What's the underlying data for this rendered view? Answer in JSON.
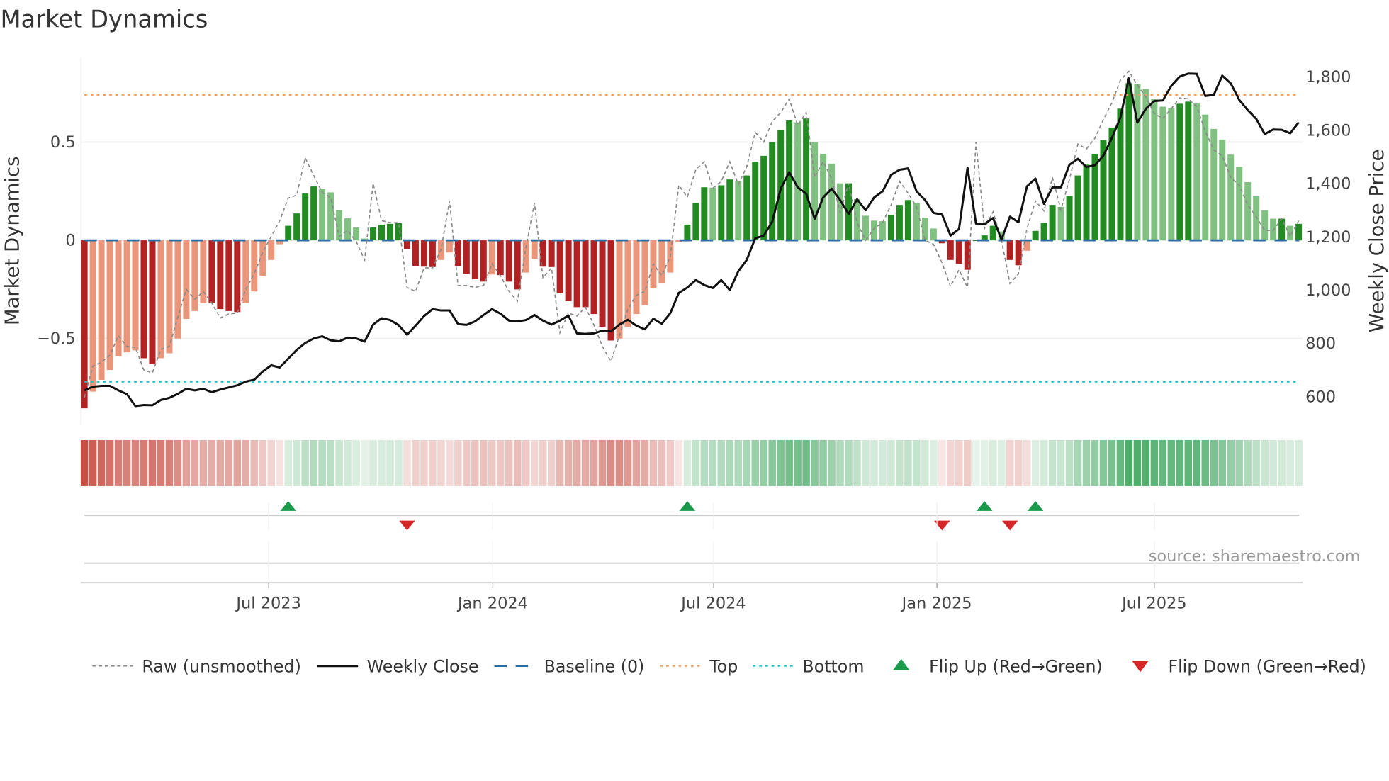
{
  "title": "Market Dynamics",
  "source": "source: sharemaestro.com",
  "colors": {
    "bar_up_strong": "#228b22",
    "bar_up_weak": "#80c080",
    "bar_down_strong": "#b22222",
    "bar_down_weak": "#e9967a",
    "raw": "#888888",
    "close": "#111111",
    "baseline": "#2b6ea6",
    "top": "#f0a060",
    "bottom": "#20c0d0",
    "flip_up": "#1a9a4a",
    "flip_down": "#d62728",
    "heat_red": "#c0392b",
    "heat_green": "#2e9e4f"
  },
  "chart_data": {
    "type": "bar+line",
    "title": "Market Dynamics",
    "ylabel": "Market Dynamics",
    "y2label": "Weekly Close Price",
    "ylim": [
      -0.94,
      0.93
    ],
    "y2lim": [
      494,
      1873
    ],
    "yticks": [
      {
        "value": -0.5,
        "label": "−0.5"
      },
      {
        "value": 0,
        "label": "0"
      },
      {
        "value": 0.5,
        "label": "0.5"
      }
    ],
    "y2ticks": [
      {
        "value": 600,
        "label": "600"
      },
      {
        "value": 800,
        "label": "800"
      },
      {
        "value": 1000,
        "label": "1,000"
      },
      {
        "value": 1200,
        "label": "1,200"
      },
      {
        "value": 1400,
        "label": "1,400"
      },
      {
        "value": 1600,
        "label": "1,600"
      },
      {
        "value": 1800,
        "label": "1,800"
      }
    ],
    "xticks": [
      {
        "label": "Jul 2023",
        "week_index": 21.7
      },
      {
        "label": "Jan 2024",
        "week_index": 48.1
      },
      {
        "label": "Jul 2024",
        "week_index": 74.1
      },
      {
        "label": "Jan 2025",
        "week_index": 100.4
      },
      {
        "label": "Jul 2025",
        "week_index": 126.0
      }
    ],
    "top_level": 0.74,
    "bottom_level": -0.72,
    "baseline": 0,
    "grid": true,
    "legend_position": "bottom",
    "smoothed": [
      -0.855,
      -0.77,
      -0.71,
      -0.66,
      -0.59,
      -0.57,
      -0.56,
      -0.6,
      -0.63,
      -0.6,
      -0.575,
      -0.5,
      -0.4,
      -0.36,
      -0.32,
      -0.32,
      -0.35,
      -0.36,
      -0.365,
      -0.32,
      -0.26,
      -0.18,
      -0.1,
      -0.02,
      0.074,
      0.137,
      0.238,
      0.274,
      0.262,
      0.244,
      0.154,
      0.112,
      0.065,
      0.009,
      0.065,
      0.08,
      0.084,
      0.087,
      -0.045,
      -0.13,
      -0.134,
      -0.136,
      -0.1,
      -0.062,
      -0.13,
      -0.17,
      -0.197,
      -0.21,
      -0.174,
      -0.177,
      -0.21,
      -0.25,
      -0.164,
      -0.094,
      -0.134,
      -0.136,
      -0.27,
      -0.31,
      -0.34,
      -0.34,
      -0.375,
      -0.44,
      -0.51,
      -0.5,
      -0.44,
      -0.375,
      -0.33,
      -0.245,
      -0.22,
      -0.164,
      -0.01,
      0.08,
      0.19,
      0.27,
      0.268,
      0.28,
      0.31,
      0.3,
      0.33,
      0.4,
      0.43,
      0.5,
      0.56,
      0.61,
      0.6,
      0.62,
      0.5,
      0.44,
      0.39,
      0.29,
      0.29,
      0.21,
      0.125,
      0.1,
      0.097,
      0.13,
      0.18,
      0.205,
      0.19,
      0.115,
      0.06,
      -0.015,
      -0.1,
      -0.12,
      -0.15,
      0.0,
      0.025,
      0.074,
      0.045,
      -0.1,
      -0.127,
      -0.053,
      0.048,
      0.089,
      0.18,
      0.17,
      0.226,
      0.33,
      0.385,
      0.44,
      0.51,
      0.574,
      0.67,
      0.8,
      0.795,
      0.77,
      0.72,
      0.68,
      0.675,
      0.695,
      0.706,
      0.696,
      0.64,
      0.567,
      0.513,
      0.436,
      0.375,
      0.296,
      0.224,
      0.153,
      0.11,
      0.11,
      0.074,
      0.084
    ],
    "raw": [
      -0.8,
      -0.64,
      -0.62,
      -0.585,
      -0.485,
      -0.54,
      -0.545,
      -0.66,
      -0.675,
      -0.555,
      -0.54,
      -0.39,
      -0.25,
      -0.3,
      -0.26,
      -0.32,
      -0.395,
      -0.375,
      -0.37,
      -0.25,
      -0.17,
      -0.06,
      0.02,
      0.1,
      0.215,
      0.23,
      0.42,
      0.33,
      0.244,
      0.217,
      0.02,
      0.05,
      -0.005,
      -0.1,
      0.29,
      0.1,
      0.09,
      0.09,
      -0.24,
      -0.26,
      -0.14,
      -0.14,
      -0.046,
      0.2,
      -0.23,
      -0.23,
      -0.24,
      -0.23,
      -0.12,
      -0.18,
      -0.26,
      -0.31,
      -0.035,
      0.19,
      -0.19,
      -0.14,
      -0.47,
      -0.37,
      -0.385,
      -0.34,
      -0.43,
      -0.54,
      -0.615,
      -0.485,
      -0.35,
      -0.28,
      -0.26,
      -0.12,
      -0.18,
      -0.08,
      0.28,
      0.22,
      0.36,
      0.4,
      0.265,
      0.3,
      0.4,
      0.285,
      0.375,
      0.55,
      0.5,
      0.605,
      0.65,
      0.72,
      0.585,
      0.65,
      0.32,
      0.4,
      0.315,
      0.14,
      0.29,
      0.09,
      0.0,
      0.06,
      0.09,
      0.18,
      0.3,
      0.24,
      0.17,
      0.0,
      -0.02,
      -0.115,
      -0.235,
      -0.15,
      -0.24,
      0.5,
      0.06,
      0.145,
      0.0,
      -0.22,
      -0.17,
      0.06,
      0.2,
      0.15,
      0.32,
      0.155,
      0.31,
      0.49,
      0.465,
      0.52,
      0.615,
      0.7,
      0.815,
      0.86,
      0.79,
      0.73,
      0.645,
      0.62,
      0.67,
      0.725,
      0.72,
      0.68,
      0.555,
      0.46,
      0.43,
      0.32,
      0.28,
      0.18,
      0.12,
      0.05,
      0.05,
      0.11,
      0.02,
      0.1
    ],
    "weekly_close": [
      624,
      638,
      641,
      641,
      624,
      610,
      565,
      569,
      568,
      588,
      596,
      611,
      630,
      624,
      630,
      617,
      627,
      635,
      643,
      657,
      664,
      695,
      718,
      710,
      743,
      776,
      802,
      819,
      827,
      812,
      808,
      822,
      819,
      807,
      871,
      895,
      888,
      869,
      833,
      867,
      903,
      929,
      924,
      924,
      873,
      870,
      883,
      907,
      929,
      912,
      886,
      883,
      888,
      907,
      886,
      871,
      886,
      905,
      838,
      836,
      838,
      848,
      845,
      871,
      889,
      867,
      853,
      893,
      874,
      914,
      990,
      1010,
      1038,
      1019,
      1008,
      1038,
      1000,
      1071,
      1114,
      1195,
      1205,
      1257,
      1381,
      1443,
      1386,
      1362,
      1267,
      1348,
      1381,
      1338,
      1286,
      1341,
      1300,
      1348,
      1371,
      1433,
      1452,
      1457,
      1371,
      1338,
      1290,
      1284,
      1205,
      1230,
      1460,
      1250,
      1248,
      1271,
      1190,
      1276,
      1255,
      1390,
      1419,
      1324,
      1386,
      1386,
      1471,
      1493,
      1462,
      1469,
      1505,
      1571,
      1648,
      1795,
      1629,
      1681,
      1710,
      1712,
      1767,
      1802,
      1813,
      1812,
      1729,
      1733,
      1805,
      1776,
      1714,
      1676,
      1643,
      1586,
      1603,
      1602,
      1589,
      1630
    ],
    "flip_up_weeks": [
      24,
      71,
      106,
      112
    ],
    "flip_down_weeks": [
      38,
      101,
      109
    ]
  },
  "legend": [
    {
      "label": "Raw (unsmoothed)",
      "icon": "dashed-line"
    },
    {
      "label": "Weekly Close",
      "icon": "solid-line"
    },
    {
      "label": "Baseline (0)",
      "icon": "dashed-line"
    },
    {
      "label": "Top",
      "icon": "dotted-line"
    },
    {
      "label": "Bottom",
      "icon": "dotted-line"
    },
    {
      "label": "Flip Up (Red→Green)",
      "icon": "triangle-up"
    },
    {
      "label": "Flip Down (Green→Red)",
      "icon": "triangle-down"
    }
  ]
}
